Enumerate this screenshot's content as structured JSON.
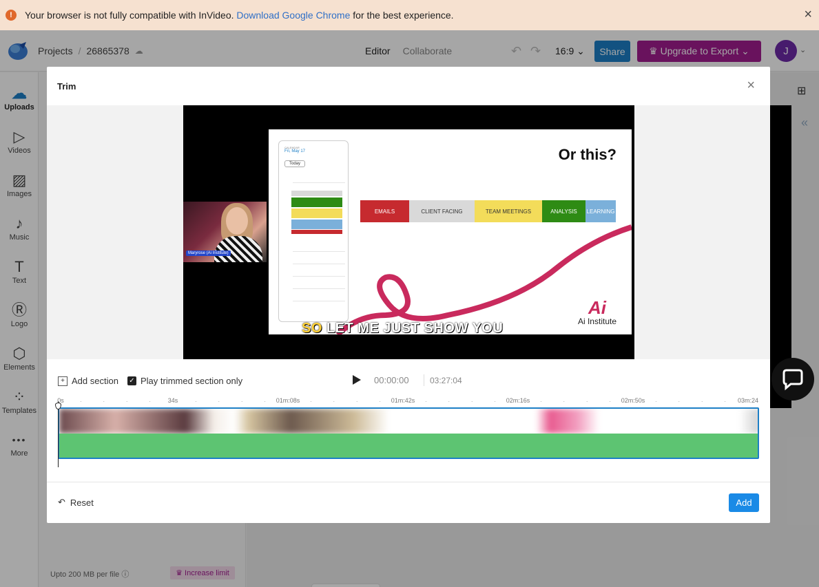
{
  "banner": {
    "warn_icon": "!",
    "text_before": "Your browser is not fully compatible with InVideo.",
    "link_text": "Download Google Chrome",
    "text_after": "for the best experience.",
    "close_icon": "×"
  },
  "header": {
    "breadcrumb_projects": "Projects",
    "breadcrumb_sep": "/",
    "project_id": "26865378",
    "cloud_icon": "☁",
    "mode_editor": "Editor",
    "mode_collaborate": "Collaborate",
    "undo_icon": "↶",
    "redo_icon": "↷",
    "aspect_ratio": "16:9 ⌄",
    "share_label": "Share",
    "upgrade_label": "♛ Upgrade to Export ⌄",
    "avatar_initial": "J",
    "avatar_chev": "⌄"
  },
  "sidebar": {
    "items": [
      {
        "label": "Uploads",
        "icon": "☁"
      },
      {
        "label": "Videos",
        "icon": "▷"
      },
      {
        "label": "Images",
        "icon": "▨"
      },
      {
        "label": "Music",
        "icon": "♪"
      },
      {
        "label": "Text",
        "icon": "T"
      },
      {
        "label": "Logo",
        "icon": "Ⓡ"
      },
      {
        "label": "Elements",
        "icon": "⬡"
      },
      {
        "label": "Templates",
        "icon": "⁘"
      },
      {
        "label": "More",
        "icon": "•••"
      }
    ]
  },
  "panel": {
    "upload_limit": "Upto 200 MB per file",
    "info_icon": "ⓘ",
    "increase_limit": "♛ Increase limit"
  },
  "icons": {
    "grid": "⊞",
    "collapse": "«"
  },
  "trim_modal": {
    "title": "Trim",
    "close_icon": "×",
    "slide_title": "Or this?",
    "calendar_small_label": "CALENDAR",
    "calendar_date": "Fri, May 17",
    "calendar_today": "Today",
    "bars": [
      {
        "label": "EMAILS",
        "color": "#c62a2f",
        "text_color": "#ffffff"
      },
      {
        "label": "CLIENT FACING",
        "color": "#d9d9d9",
        "text_color": "#333333"
      },
      {
        "label": "TEAM MEETINGS",
        "color": "#f3dc5a",
        "text_color": "#333333"
      },
      {
        "label": "ANALYSIS",
        "color": "#2e8b14",
        "text_color": "#ffffff"
      },
      {
        "label": "LEARNING",
        "color": "#7bb0da",
        "text_color": "#ffffff"
      }
    ],
    "ai_logo_mark": "Ai",
    "ai_logo_name": "Ai Institute",
    "caption_highlight": "SO",
    "caption_rest": "LET ME JUST SHOW YOU",
    "presenter_tag": "Maryrose (Ai Institute)",
    "add_section_icon": "+",
    "add_section": "Add section",
    "check_icon": "✓",
    "play_trimmed_only": "Play trimmed section only",
    "current_time": "00:00:00",
    "total_time": "03:27:04",
    "ruler_labels": [
      "0s",
      "34s",
      "01m:08s",
      "01m:42s",
      "02m:16s",
      "02m:50s",
      "03m:24"
    ],
    "reset_icon": "↶",
    "reset_label": "Reset",
    "add_label": "Add"
  }
}
